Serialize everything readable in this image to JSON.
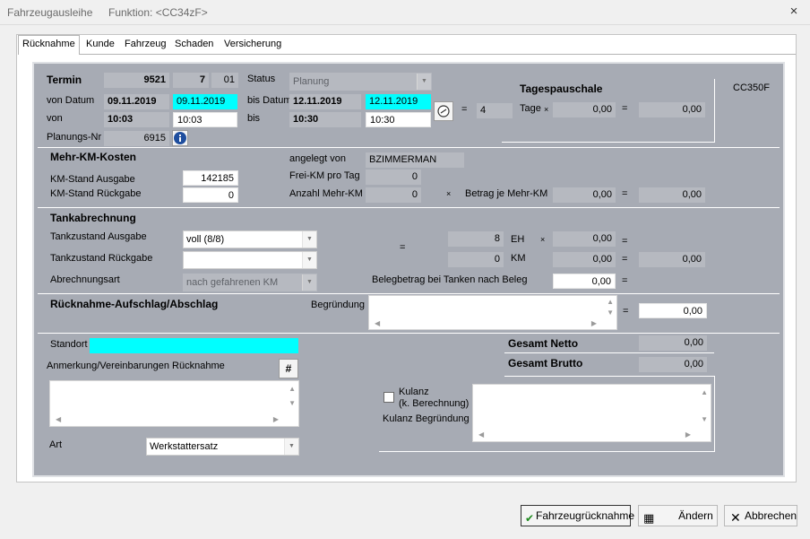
{
  "window": {
    "title": "Fahrzeugausleihe",
    "function_label": "Funktion: <CC34zF>",
    "close_symbol": "×"
  },
  "tabs": [
    "Rücknahme",
    "Kunde",
    "Fahrzeug",
    "Schaden",
    "Versicherung"
  ],
  "termin": {
    "label": "Termin",
    "number": "9521",
    "sub": "7",
    "sub2": "01",
    "status_label": "Status",
    "status_value": "Planung",
    "von_datum_label": "von Datum",
    "von_datum": "09.11.2019",
    "von_datum_input": "09.11.2019",
    "bis_datum_label": "bis Datum",
    "bis_datum": "12.11.2019",
    "bis_datum_input": "12.11.2019",
    "von_label": "von",
    "von_time": "10:03",
    "von_time_input": "10:03",
    "bis_label": "bis",
    "bis_time": "10:30",
    "bis_time_input": "10:30",
    "planungs_nr_label": "Planungs-Nr",
    "planungs_nr": "6915",
    "equals": "=",
    "days": "4"
  },
  "tagespauschale": {
    "title": "Tagespauschale",
    "tage_label": "Tage",
    "times": "×",
    "rate": "0,00",
    "equals": "=",
    "total": "0,00",
    "vehicle_code": "CC350F"
  },
  "mehr_km": {
    "title": "Mehr-KM-Kosten",
    "ausgabe_label": "KM-Stand Ausgabe",
    "ausgabe_value": "142185",
    "rueckgabe_label": "KM-Stand Rückgabe",
    "rueckgabe_value": "0",
    "angelegt_label": "angelegt von",
    "angelegt_value": "BZIMMERMAN",
    "frei_km_label": "Frei-KM pro Tag",
    "frei_km_value": "0",
    "anzahl_label": "Anzahl Mehr-KM",
    "anzahl_value": "0",
    "times": "×",
    "betrag_label": "Betrag je Mehr-KM",
    "betrag_value": "0,00",
    "equals": "=",
    "total": "0,00"
  },
  "tank": {
    "title": "Tankabrechnung",
    "ausgabe_label": "Tankzustand Ausgabe",
    "ausgabe_value": "voll (8/8)",
    "rueckgabe_label": "Tankzustand Rückgabe",
    "rueckgabe_value": "",
    "abrechnung_label": "Abrechnungsart",
    "abrechnung_value": "nach gefahrenen KM",
    "equals": "=",
    "eh_value": "8",
    "eh_label": "EH",
    "km_value": "0",
    "km_label": "KM",
    "times": "×",
    "eh_rate": "0,00",
    "km_rate": "0,00",
    "km_total": "0,00",
    "beleg_label": "Belegbetrag bei Tanken nach Beleg",
    "beleg_value": "0,00"
  },
  "aufschlag": {
    "title": "Rücknahme-Aufschlag/Abschlag",
    "begruendung_label": "Begründung",
    "equals": "=",
    "value": "0,00"
  },
  "footer_section": {
    "standort_label": "Standort",
    "anmerkung_label": "Anmerkung/Vereinbarungen Rücknahme",
    "hash_button": "#",
    "art_label": "Art",
    "art_value": "Werkstattersatz",
    "gesamt_netto_label": "Gesamt Netto",
    "gesamt_netto_value": "0,00",
    "gesamt_brutto_label": "Gesamt Brutto",
    "gesamt_brutto_value": "0,00",
    "kulanz_label_1": "Kulanz",
    "kulanz_label_2": "(k. Berechnung)",
    "kulanz_begruendung_label": "Kulanz Begründung"
  },
  "buttons": {
    "rueckgabe": "Fahrzeugrücknahme",
    "aendern": "Ändern",
    "abbrechen": "Abbrechen"
  },
  "colors": {
    "panel": "#a7abb4",
    "readonly": "#b6b9c0",
    "highlight": "#00ffff"
  }
}
